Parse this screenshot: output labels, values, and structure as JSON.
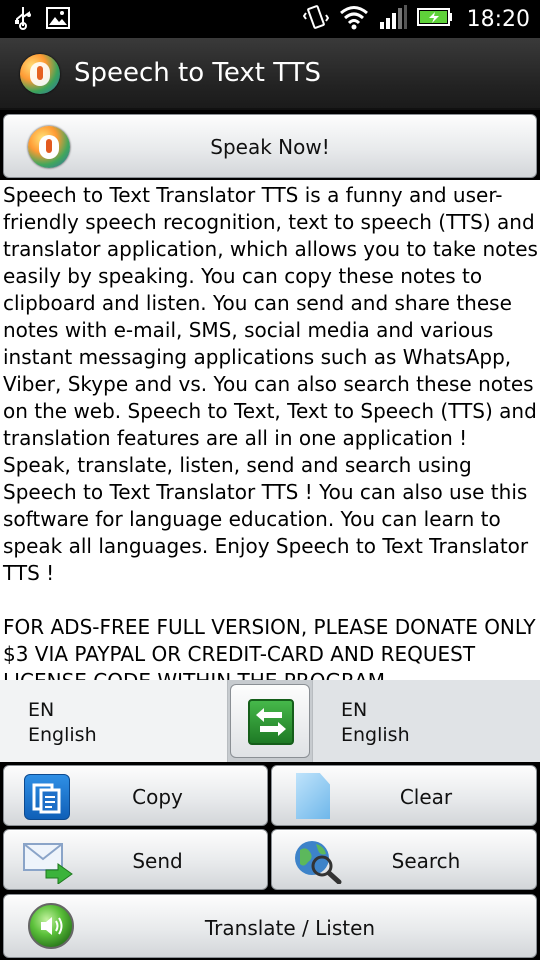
{
  "status_bar": {
    "time": "18:20",
    "icons": [
      "usb-icon",
      "image-icon",
      "vibrate-icon",
      "wifi-icon",
      "signal-icon",
      "battery-icon"
    ]
  },
  "app": {
    "title": "Speech to Text TTS",
    "accent": "#2f6ab7"
  },
  "speak_button": {
    "label": "Speak Now!"
  },
  "notes": {
    "paragraph1": "Speech to Text Translator TTS is a funny and user-friendly speech recognition, text to speech (TTS) and translator application, which allows you to take notes easily by speaking. You can copy these notes to clipboard and listen. You can send and share these notes with e-mail, SMS, social media and various instant messaging applications such as WhatsApp, Viber, Skype and vs. You can also search these notes on the web. Speech to Text, Text to Speech (TTS) and translation features are all in one application ! Speak, translate, listen, send and search using Speech to Text Translator TTS ! You can also use this software for language education. You can learn to speak all languages. Enjoy Speech to Text Translator TTS !",
    "paragraph2": "FOR ADS-FREE FULL VERSION, PLEASE DONATE ONLY $3 VIA PAYPAL OR CREDIT-CARD AND REQUEST LICENSE CODE WITHIN THE PROGRAM"
  },
  "languages": {
    "source": {
      "code": "EN",
      "name": "English"
    },
    "target": {
      "code": "EN",
      "name": "English"
    }
  },
  "actions": {
    "copy": "Copy",
    "clear": "Clear",
    "send": "Send",
    "search": "Search",
    "translate_listen": "Translate / Listen"
  }
}
